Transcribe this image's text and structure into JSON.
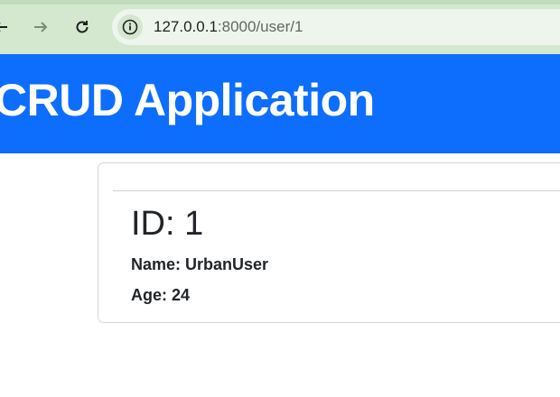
{
  "browser": {
    "url_host": "127.0.0.1",
    "url_path": ":8000/user/1",
    "back_icon": "arrow-left-icon",
    "forward_icon": "arrow-right-icon",
    "reload_icon": "reload-icon",
    "site_info_icon": "info-icon"
  },
  "header": {
    "title": "CRUD Application",
    "background": "#0d6efd"
  },
  "user": {
    "id_label": "ID: 1",
    "name_label": "Name: UrbanUser",
    "age_label": "Age: 24"
  }
}
